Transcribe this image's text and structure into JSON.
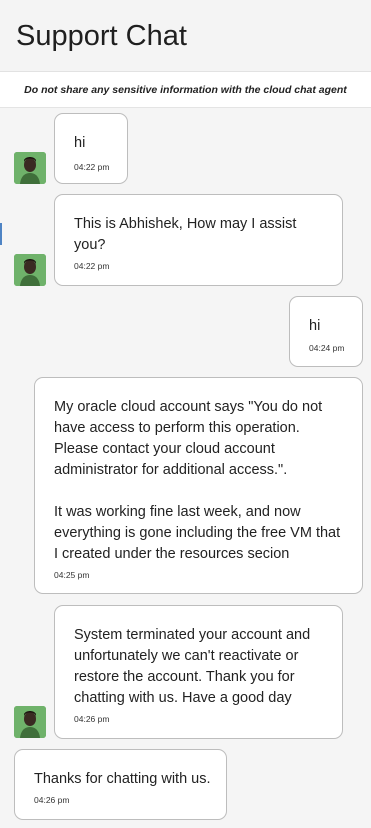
{
  "header": {
    "title": "Support Chat"
  },
  "notice": {
    "text": "Do not share any sensitive information with the cloud chat agent"
  },
  "messages": [
    {
      "sender": "agent",
      "text": "hi",
      "time": "04:22 pm"
    },
    {
      "sender": "agent",
      "text": "This is Abhishek, How may I assist you?",
      "time": "04:22 pm"
    },
    {
      "sender": "user",
      "text": "hi",
      "time": "04:24 pm"
    },
    {
      "sender": "user",
      "text": "My oracle cloud account says \"You do not have access to perform this operation. Please contact your cloud account administrator for additional access.\".\n\nIt was working fine last week, and now everything is gone including the free VM that I created under the resources secion",
      "time": "04:25 pm"
    },
    {
      "sender": "agent",
      "text": "System terminated your account and unfortunately we can't reactivate or restore the account. Thank you for chatting with us. Have a good day",
      "time": "04:26 pm"
    },
    {
      "sender": "system",
      "text": "Thanks for chatting with us.",
      "time": "04:26 pm"
    }
  ],
  "icons": {
    "agent_avatar": "agent-avatar-icon"
  },
  "colors": {
    "bubble_bg": "#ffffff",
    "bubble_border": "#bdbdbd",
    "avatar_green": "#6fb26a"
  }
}
